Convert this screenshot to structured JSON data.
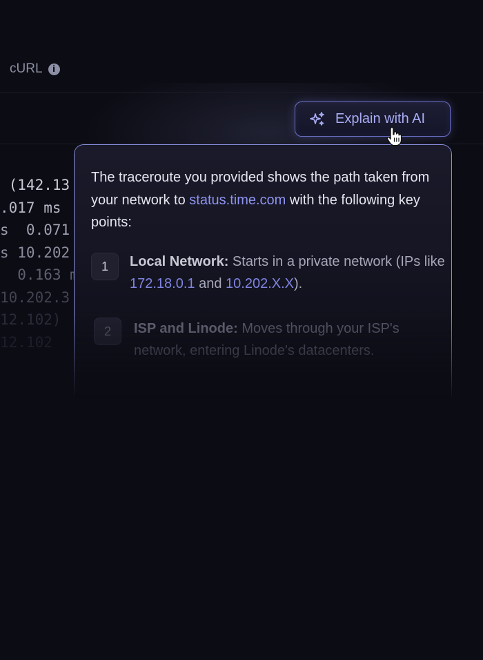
{
  "tabs": {
    "curl_label": "cURL",
    "info_icon_glyph": "i"
  },
  "terminal_lines": [
    {
      "text": " (142.13",
      "color": "#c9cad6"
    },
    {
      "text": ".017 ms",
      "color": "#b7b8c6"
    },
    {
      "text": "s  0.071",
      "color": "#9fa0b0"
    },
    {
      "text": "s 10.202",
      "color": "#8b8c9c"
    },
    {
      "text": "  0.163 m",
      "color": "#5e5f70"
    },
    {
      "text": "10.202.3",
      "color": "#424352"
    },
    {
      "text": "12.102)",
      "color": "#2a2b38"
    },
    {
      "text": "12.102",
      "color": "#1d1e29"
    }
  ],
  "explain_button": {
    "label": "Explain with AI",
    "icon": "sparkle-icon",
    "color": "#a9adf4"
  },
  "popover": {
    "intro_before": "The traceroute you provided shows the path taken from your network to ",
    "intro_link": "status.time.com",
    "intro_after": " with the following key points:",
    "points": [
      {
        "number": "1",
        "title": "Local Network:",
        "text_before": " Starts in a private network (IPs like ",
        "ip1": "172.18.0.1",
        "text_middle": " and ",
        "ip2": "10.202.X.X",
        "text_after": ")."
      },
      {
        "number": "2",
        "title": "ISP and Linode:",
        "text": " Moves through your ISP's network, entering Linode's datacenters."
      }
    ]
  },
  "colors": {
    "background": "#0c0c14",
    "accent": "#8f94f0",
    "border": "#8a8fe0"
  }
}
